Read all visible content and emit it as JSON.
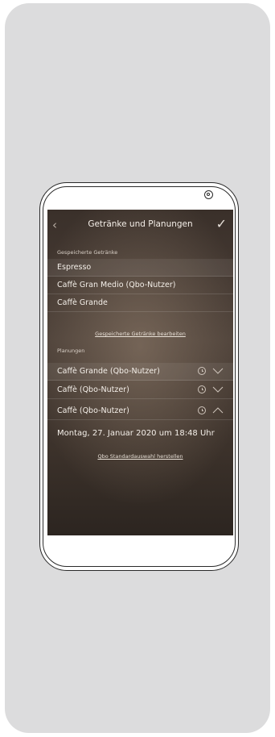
{
  "header": {
    "back_icon": "chevron-left-icon",
    "title": "Getränke und Planungen",
    "confirm_icon": "checkmark-icon"
  },
  "saved_drinks": {
    "label": "Gespeicherte Getränke",
    "items": [
      {
        "label": "Espresso"
      },
      {
        "label": "Caffè Gran Medio (Qbo-Nutzer)"
      },
      {
        "label": "Caffè Grande"
      }
    ],
    "edit_link": "Gespeicherte Getränke bearbeiten"
  },
  "schedules": {
    "label": "Planungen",
    "items": [
      {
        "label": "Caffè Grande (Qbo-Nutzer)",
        "icon": "clock-icon",
        "toggle": "chevron-down-icon"
      },
      {
        "label": "Caffè (Qbo-Nutzer)",
        "icon": "clock-icon",
        "toggle": "chevron-down-icon"
      },
      {
        "label": "Caffè (Qbo-Nutzer)",
        "icon": "clock-icon",
        "toggle": "chevron-up-icon"
      }
    ],
    "expanded_detail": "Montag, 27. Januar 2020 um 18:48 Uhr"
  },
  "footer": {
    "default_link": "Qbo Standardauswahl herstellen"
  },
  "colors": {
    "card_background": "#dcdcdd",
    "screen_background": "#4c4038",
    "text": "#f4efe9"
  }
}
